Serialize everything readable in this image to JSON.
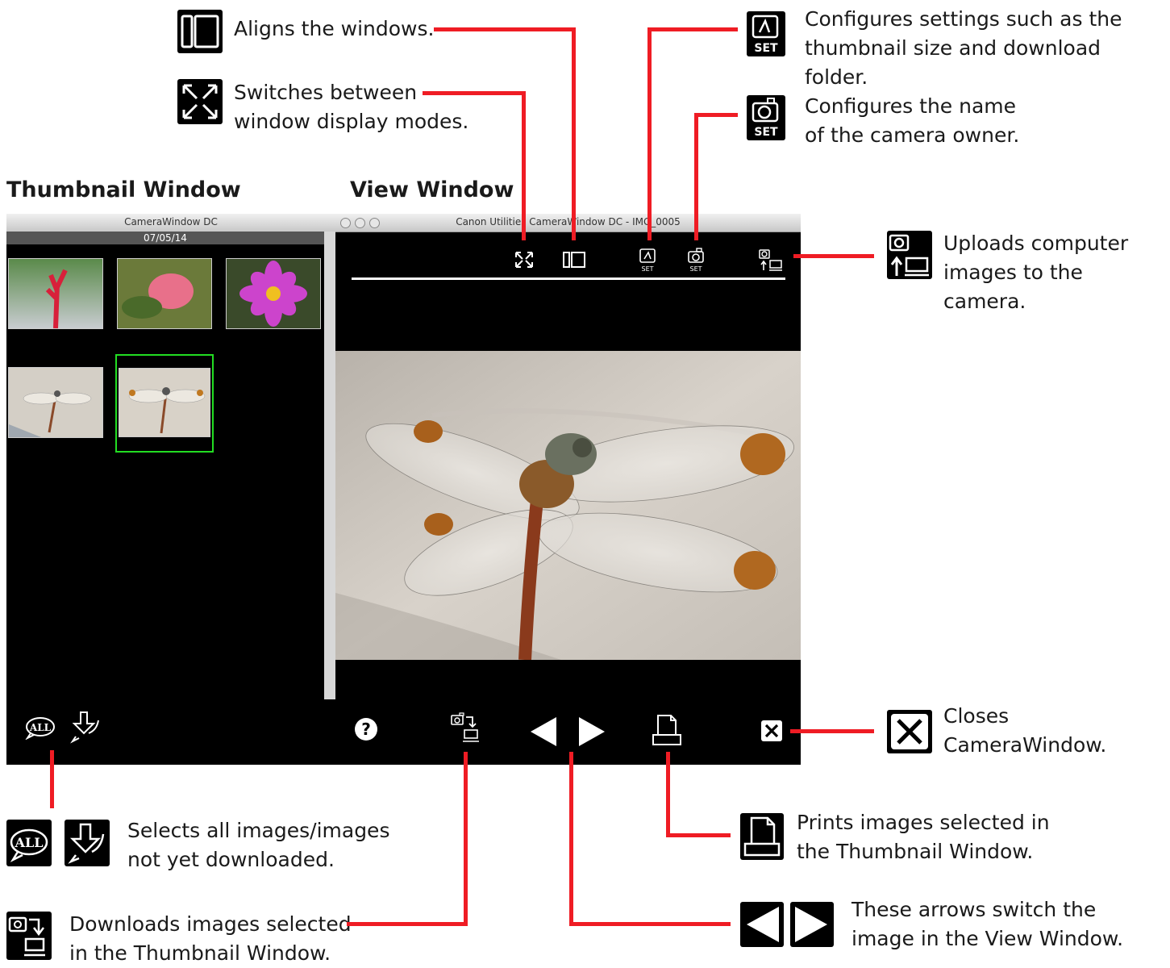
{
  "sections": {
    "thumbnail_window": "Thumbnail Window",
    "view_window": "View Window"
  },
  "thumbnail_window": {
    "title": "CameraWindow DC",
    "date": "07/05/14"
  },
  "view_window": {
    "title": "Canon Utilities CameraWindow DC - IMG_0005"
  },
  "callouts": {
    "align": "Aligns the windows.",
    "switch_modes": "Switches between\nwindow display modes.",
    "settings": "Configures settings such as the\nthumbnail size and download folder.",
    "owner": "Configures the name\nof the camera owner.",
    "upload": "Uploads computer\nimages to the camera.",
    "close": "Closes\nCameraWindow.",
    "select_all": "Selects all images/images\nnot yet downloaded.",
    "print": "Prints images selected in\nthe Thumbnail Window.",
    "download": "Downloads images selected\nin the Thumbnail Window.",
    "arrows": "These arrows switch the\nimage in the View Window."
  },
  "icons": {
    "all_label": "ALL",
    "set_label": "SET",
    "help_label": "?"
  },
  "colors": {
    "accent_line": "#ef1c24",
    "selected_thumb_border": "#22dd22",
    "window_bg": "#000000"
  }
}
